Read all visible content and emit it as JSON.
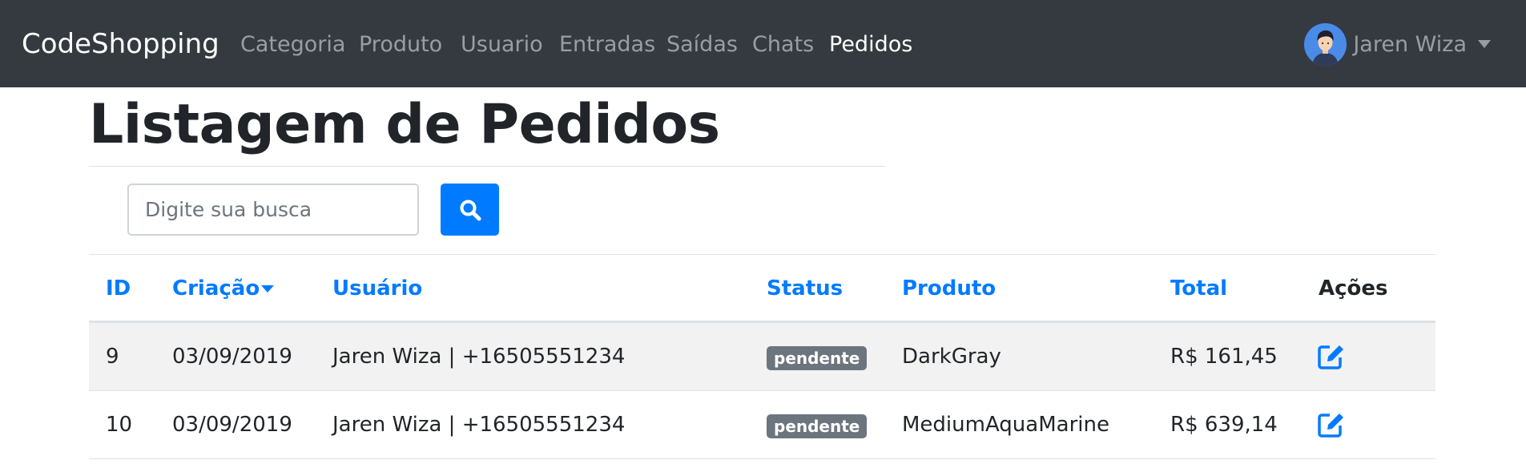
{
  "navbar": {
    "brand": "CodeShopping",
    "links": [
      "Categoria",
      "Produto",
      "Usuario",
      "Entradas",
      "Saídas",
      "Chats",
      "Pedidos"
    ],
    "active": "Pedidos",
    "user_name": "Jaren Wiza"
  },
  "page": {
    "title": "Listagem de Pedidos"
  },
  "search": {
    "placeholder": "Digite sua busca",
    "value": ""
  },
  "table": {
    "headers": [
      "ID",
      "Criação",
      "Usuário",
      "Status",
      "Produto",
      "Total",
      "Ações"
    ],
    "sorted_column": "Criação",
    "rows": [
      {
        "id": "9",
        "created": "03/09/2019",
        "user": "Jaren Wiza | +16505551234",
        "status": "pendente",
        "product": "DarkGray",
        "total": "R$ 161,45"
      },
      {
        "id": "10",
        "created": "03/09/2019",
        "user": "Jaren Wiza | +16505551234",
        "status": "pendente",
        "product": "MediumAquaMarine",
        "total": "R$ 639,14"
      }
    ]
  },
  "colors": {
    "navbar_bg": "#343a40",
    "primary": "#007bff",
    "badge_bg": "#6c757d"
  },
  "icons": {
    "search": "search-icon",
    "edit": "edit-icon",
    "avatar": "avatar",
    "dropdown": "chevron-down-icon"
  }
}
